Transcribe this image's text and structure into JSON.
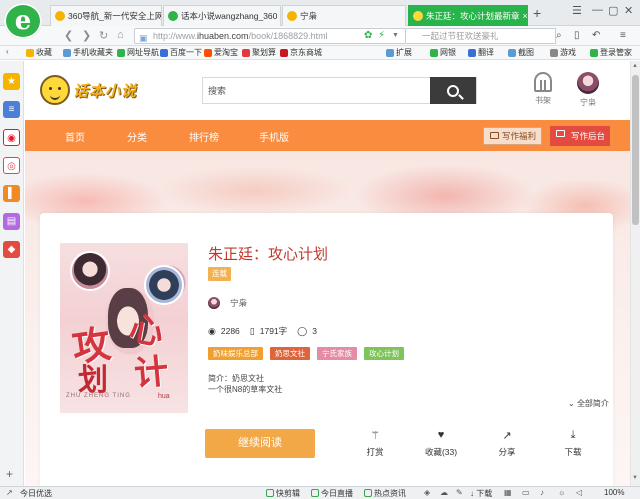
{
  "browser": {
    "tabs": [
      {
        "label": "360导航_新一代安全上网",
        "fav_color": "#f4b400",
        "close": "×"
      },
      {
        "label": "话本小说wangzhang_360",
        "fav_color": "#2fb34a",
        "close": "×"
      },
      {
        "label": "宁枭",
        "fav_color": "#f4b400",
        "close": "×"
      },
      {
        "label": "朱正廷：攻心计划最新章",
        "fav_color": "#ffd93a",
        "close": "×"
      }
    ],
    "new_tab": "+",
    "address": {
      "url_prefix": "http://www.",
      "url_domain": "ihuaben.com",
      "url_path": "/book/1868829.html"
    },
    "search_hint": "一起过节狂欢送豪礼",
    "bookmarks": [
      {
        "label": "收藏",
        "color": "#f4b400"
      },
      {
        "label": "手机收藏夹",
        "color": "#5b9bd5"
      },
      {
        "label": "网址导航",
        "color": "#2fb34a"
      },
      {
        "label": "百度一下",
        "color": "#3b6fd8"
      },
      {
        "label": "爱淘宝",
        "color": "#ff5000"
      },
      {
        "label": "聚划算",
        "color": "#e4393c"
      },
      {
        "label": "京东商城",
        "color": "#c91623"
      }
    ],
    "toolbar_right": [
      {
        "label": "扩展",
        "color": "#5b9bd5"
      },
      {
        "label": "网银",
        "color": "#2fb34a"
      },
      {
        "label": "翻译",
        "color": "#3b6fd8"
      },
      {
        "label": "截图",
        "color": "#5b9bd5"
      },
      {
        "label": "游戏",
        "color": "#888888"
      },
      {
        "label": "登录管家",
        "color": "#2fb34a"
      }
    ],
    "status": {
      "left": "今日优选",
      "items": [
        "快剪辑",
        "今日直播",
        "热点资讯"
      ],
      "download": "下载",
      "zoom": "100%"
    }
  },
  "site": {
    "search_placeholder": "搜索",
    "shelf_label": "书架",
    "user_label": "宁枭",
    "nav": [
      "首页",
      "分类",
      "排行榜",
      "手机版"
    ],
    "welfare_btn": "写作福利",
    "admin_btn": "写作后台"
  },
  "book": {
    "title": "朱正廷：攻心计划",
    "status": "连载",
    "author": "宁枭",
    "views": "2286",
    "words": "1791字",
    "comments": "3",
    "tags": [
      {
        "label": "奶味娱乐总部",
        "color": "#f0a030"
      },
      {
        "label": "奶思文社",
        "color": "#e0643b"
      },
      {
        "label": "宁氏家族",
        "color": "#e48ca6"
      },
      {
        "label": "攻心计划",
        "color": "#7fc45a"
      }
    ],
    "synopsis": [
      "简介：奶思文社",
      "一个很N8的草率文社"
    ],
    "expand_label": "全部简介",
    "cover_text": {
      "w1": "攻",
      "w2": "心",
      "w3": "计",
      "w4": "划",
      "w5": "hua",
      "w6": "ZHU ZHENG TING"
    },
    "read_btn": "继续阅读",
    "actions": [
      {
        "label": "打赏",
        "icon": "wand-icon"
      },
      {
        "label": "收藏(33)",
        "icon": "heart-icon"
      },
      {
        "label": "分享",
        "icon": "share-icon"
      },
      {
        "label": "下载",
        "icon": "download-icon"
      }
    ]
  }
}
